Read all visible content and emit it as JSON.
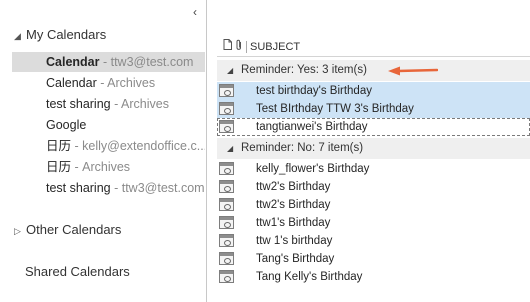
{
  "sidebar": {
    "collapse_glyph": "‹",
    "my_calendars": "My Calendars",
    "items": [
      {
        "name": "Calendar",
        "sub": " - ttw3@test.com"
      },
      {
        "name": "Calendar",
        "sub": " - Archives"
      },
      {
        "name": "test sharing",
        "sub": " - Archives"
      },
      {
        "name": "Google",
        "sub": ""
      },
      {
        "name": "日历",
        "sub": " - kelly@extendoffice.c..."
      },
      {
        "name": "日历",
        "sub": " - Archives"
      },
      {
        "name": "test sharing",
        "sub": " - ttw3@test.com"
      }
    ],
    "other_calendars": "Other Calendars",
    "shared_calendars": "Shared Calendars"
  },
  "columns": {
    "subject": "SUBJECT"
  },
  "groups": [
    {
      "title": "Reminder: Yes: 3 item(s)",
      "items": [
        "test birthday's Birthday",
        "Test BIrthday TTW 3's Birthday",
        "tangtianwei's Birthday"
      ]
    },
    {
      "title": "Reminder: No: 7 item(s)",
      "items": [
        "kelly_flower's Birthday",
        "ttw2's Birthday",
        "ttw2's Birthday",
        "ttw1's Birthday",
        "ttw 1's birthday",
        "Tang's Birthday",
        "Tang Kelly's Birthday"
      ]
    }
  ],
  "colors": {
    "selection": "#cde3f6",
    "arrow": "#e8663a",
    "group_bg": "#efefef"
  },
  "icons": [
    "collapse-icon",
    "expand-triangle-icon",
    "collapsed-triangle-icon",
    "document-icon",
    "attachment-icon",
    "calendar-icon",
    "annotation-arrow-icon"
  ]
}
